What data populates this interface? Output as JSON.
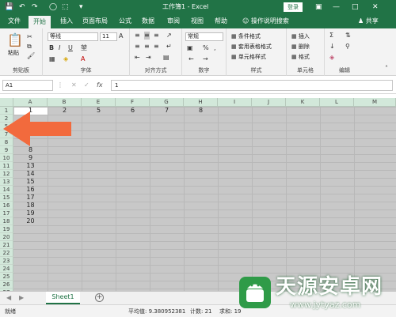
{
  "titlebar": {
    "title": "工作簿1 - Excel",
    "login": "登录"
  },
  "tabs": [
    "文件",
    "开始",
    "插入",
    "页面布局",
    "公式",
    "数据",
    "审阅",
    "视图",
    "帮助"
  ],
  "search_label": "操作说明搜索",
  "share_label": "共享",
  "ribbon": {
    "clipboard": {
      "paste": "粘贴",
      "label": "剪贴板"
    },
    "font": {
      "name": "等线",
      "size": "11",
      "label": "字体"
    },
    "alignment": {
      "label": "对齐方式"
    },
    "number": {
      "format": "常规",
      "label": "数字"
    },
    "styles": {
      "cond": "条件格式",
      "table": "套用表格格式",
      "cell": "单元格样式",
      "label": "样式"
    },
    "cells": {
      "insert": "插入",
      "delete": "删除",
      "format": "格式",
      "label": "单元格"
    },
    "editing": {
      "label": "编辑"
    }
  },
  "formula_bar": {
    "name_box": "A1",
    "value": "1"
  },
  "grid": {
    "columns": [
      "A",
      "B",
      "E",
      "F",
      "G",
      "H",
      "I",
      "J",
      "K",
      "L",
      "M"
    ],
    "rows": [
      "1",
      "2",
      "5",
      "7",
      "8",
      "9",
      "10",
      "11",
      "12",
      "13",
      "14",
      "15",
      "16",
      "17",
      "18",
      "19",
      "20",
      "21",
      "22",
      "23",
      "24",
      "25",
      "26",
      "27"
    ],
    "row1_values": [
      "1",
      "2",
      "5",
      "6",
      "7",
      "8"
    ],
    "colA_values": {
      "r8": "8",
      "r9": "9",
      "r10": "13",
      "r11": "14",
      "r12": "15",
      "r13": "16",
      "r14": "17",
      "r15": "18",
      "r16": "19",
      "r17": "20"
    }
  },
  "sheet_tab": "Sheet1",
  "status": {
    "ready": "就绪",
    "average": "平均值: 9.380952381",
    "count": "计数: 21",
    "sum": "求和: 19"
  },
  "watermark": {
    "title": "天源安卓网",
    "url": "www.jytyaz.com"
  },
  "colors": {
    "excel_green": "#217346",
    "selection_gray": "#c8c8c8",
    "arrow": "#f26a3d"
  }
}
